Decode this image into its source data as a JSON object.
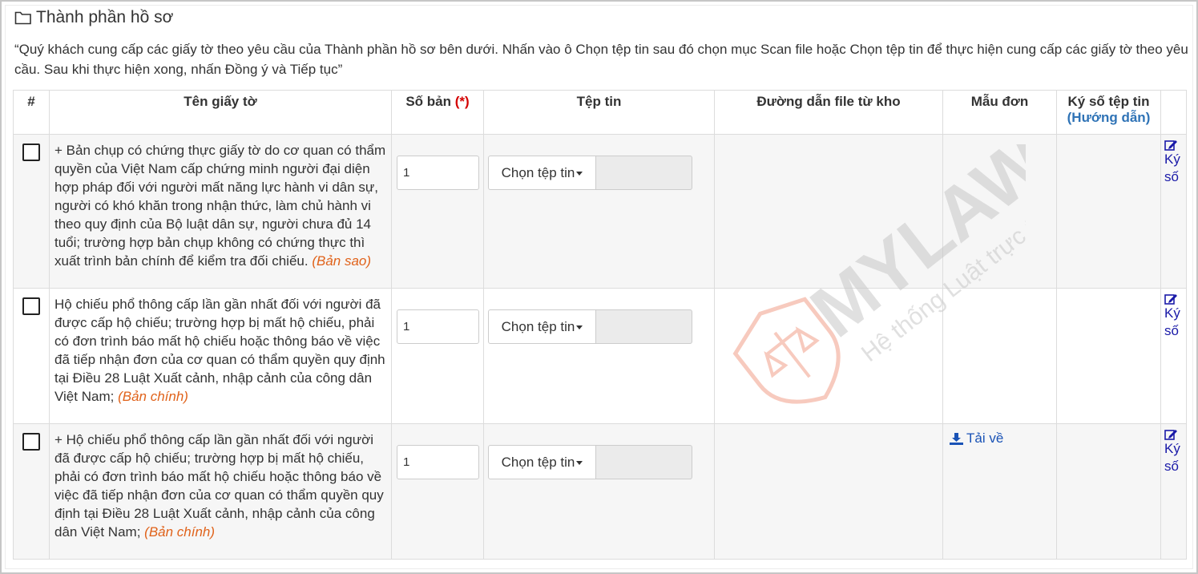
{
  "section": {
    "title": "Thành phần hồ sơ",
    "icon": "folder-open-icon"
  },
  "intro": "“Quý khách cung cấp các giấy tờ theo yêu cầu của Thành phần hồ sơ bên dưới. Nhấn vào ô Chọn tệp tin sau đó chọn mục Scan file hoặc Chọn tệp tin để thực hiện cung cấp các giấy tờ theo yêu cầu. Sau khi thực hiện xong, nhấn Đồng ý và Tiếp tục”",
  "table": {
    "headers": {
      "index": "#",
      "name": "Tên giấy tờ",
      "copies": "Số bản",
      "copies_required": "(*)",
      "file": "Tệp tin",
      "path": "Đường dẫn file từ kho",
      "template": "Mẫu đơn",
      "sign": "Ký số tệp tin",
      "sign_guide": "(Hướng dẫn)"
    },
    "rows": [
      {
        "name": "+ Bản chụp có chứng thực giấy tờ do cơ quan có thẩm quyền của Việt Nam cấp chứng minh người đại diện hợp pháp đối với người mất năng lực hành vi dân sự, người có khó khăn trong nhận thức, làm chủ hành vi theo quy định của Bộ luật dân sự, người chưa đủ 14 tuổi; trường hợp bản chụp không có chứng thực thì xuất trình bản chính để kiểm tra đối chiếu.",
        "note": "(Bản sao)",
        "copies": "1",
        "file_button": "Chọn tệp tin",
        "template_link": "",
        "sign_label": "Ký số"
      },
      {
        "name": "Hộ chiếu phổ thông cấp lần gần nhất đối với người đã được cấp hộ chiếu; trường hợp bị mất hộ chiếu, phải có đơn trình báo mất hộ chiếu hoặc thông báo về việc đã tiếp nhận đơn của cơ quan có thẩm quyền quy định tại Điều 28 Luật Xuất cảnh, nhập cảnh của công dân Việt Nam;",
        "note": "(Bản chính)",
        "copies": "1",
        "file_button": "Chọn tệp tin",
        "template_link": "",
        "sign_label": "Ký số"
      },
      {
        "name": "+ Hộ chiếu phổ thông cấp lần gần nhất đối với người đã được cấp hộ chiếu; trường hợp bị mất hộ chiếu, phải có đơn trình báo mất hộ chiếu hoặc thông báo về việc đã tiếp nhận đơn của cơ quan có thẩm quyền quy định tại Điều 28 Luật Xuất cảnh, nhập cảnh của công dân Việt Nam;",
        "note": "(Bản chính)",
        "copies": "1",
        "file_button": "Chọn tệp tin",
        "template_link": "Tải về",
        "sign_label": "Ký số"
      }
    ]
  },
  "watermark": {
    "brand": "MYLAW",
    "tagline": "Hệ thống Luật trực tuyến"
  },
  "colors": {
    "link": "#2f73b6",
    "required": "#d40000",
    "note": "#e0621a",
    "sign": "#1a1aa8"
  }
}
